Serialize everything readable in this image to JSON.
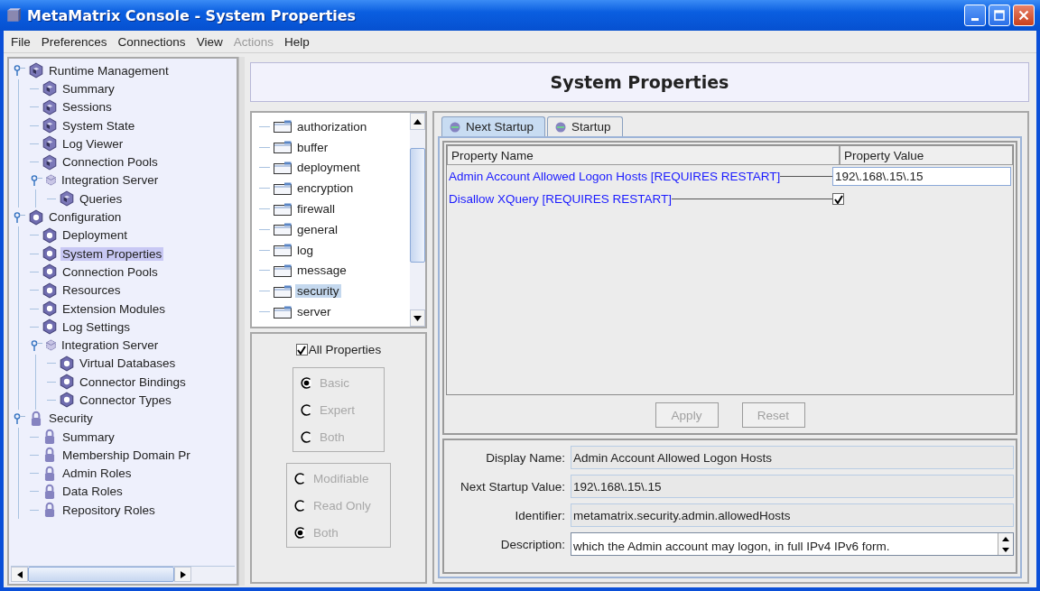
{
  "window": {
    "title": "MetaMatrix Console  - System Properties"
  },
  "menu": [
    {
      "label": "File",
      "disabled": false
    },
    {
      "label": "Preferences",
      "disabled": false
    },
    {
      "label": "Connections",
      "disabled": false
    },
    {
      "label": "View",
      "disabled": false
    },
    {
      "label": "Actions",
      "disabled": true
    },
    {
      "label": "Help",
      "disabled": false
    }
  ],
  "navigation_tree": [
    {
      "label": "Runtime Management",
      "kind": "runtime",
      "selected": false,
      "expanded": true,
      "children": [
        {
          "label": "Summary",
          "kind": "runtime",
          "selected": false
        },
        {
          "label": "Sessions",
          "kind": "runtime",
          "selected": false
        },
        {
          "label": "System State",
          "kind": "runtime",
          "selected": false
        },
        {
          "label": "Log Viewer",
          "kind": "runtime",
          "selected": false
        },
        {
          "label": "Connection Pools",
          "kind": "runtime",
          "selected": false
        },
        {
          "label": "Integration Server",
          "kind": "server",
          "selected": false,
          "expanded": true,
          "children": [
            {
              "label": "Queries",
              "kind": "runtime",
              "selected": false
            }
          ]
        }
      ]
    },
    {
      "label": "Configuration",
      "kind": "config",
      "selected": false,
      "expanded": true,
      "children": [
        {
          "label": "Deployment",
          "kind": "config",
          "selected": false
        },
        {
          "label": "System Properties",
          "kind": "config",
          "selected": true
        },
        {
          "label": "Connection Pools",
          "kind": "config",
          "selected": false
        },
        {
          "label": "Resources",
          "kind": "config",
          "selected": false
        },
        {
          "label": "Extension Modules",
          "kind": "config",
          "selected": false
        },
        {
          "label": "Log Settings",
          "kind": "config",
          "selected": false
        },
        {
          "label": "Integration Server",
          "kind": "server",
          "selected": false,
          "expanded": true,
          "children": [
            {
              "label": "Virtual Databases",
              "kind": "config",
              "selected": false
            },
            {
              "label": "Connector Bindings",
              "kind": "config",
              "selected": false
            },
            {
              "label": "Connector Types",
              "kind": "config",
              "selected": false
            }
          ]
        }
      ]
    },
    {
      "label": "Security",
      "kind": "security",
      "selected": false,
      "expanded": true,
      "children": [
        {
          "label": "Summary",
          "kind": "security",
          "selected": false
        },
        {
          "label": "Membership Domain Pr",
          "kind": "security",
          "selected": false
        },
        {
          "label": "Admin Roles",
          "kind": "security",
          "selected": false
        },
        {
          "label": "Data Roles",
          "kind": "security",
          "selected": false
        },
        {
          "label": "Repository Roles",
          "kind": "security",
          "selected": false
        }
      ]
    }
  ],
  "page_title": "System Properties",
  "categories": [
    {
      "label": "authorization",
      "selected": false
    },
    {
      "label": "buffer",
      "selected": false
    },
    {
      "label": "deployment",
      "selected": false
    },
    {
      "label": "encryption",
      "selected": false
    },
    {
      "label": "firewall",
      "selected": false
    },
    {
      "label": "general",
      "selected": false
    },
    {
      "label": "log",
      "selected": false
    },
    {
      "label": "message",
      "selected": false
    },
    {
      "label": "security",
      "selected": true
    },
    {
      "label": "server",
      "selected": false
    }
  ],
  "filters": {
    "all_properties": {
      "label": "All Properties",
      "checked": true
    },
    "groups": [
      {
        "disabled": true,
        "options": [
          {
            "label": "Basic",
            "selected": true
          },
          {
            "label": "Expert",
            "selected": false
          },
          {
            "label": "Both",
            "selected": false
          }
        ]
      },
      {
        "disabled": true,
        "options": [
          {
            "label": "Modifiable",
            "selected": false
          },
          {
            "label": "Read Only",
            "selected": false
          },
          {
            "label": "Both",
            "selected": true
          }
        ]
      }
    ]
  },
  "tabs": [
    {
      "label": "Next Startup",
      "selected": true
    },
    {
      "label": "Startup",
      "selected": false
    }
  ],
  "table": {
    "columns": [
      "Property Name",
      "Property Value"
    ],
    "rows": [
      {
        "name": "Admin Account Allowed Logon Hosts [REQUIRES RESTART]",
        "kind": "text",
        "value": "192\\.168\\.15\\.15"
      },
      {
        "name": "Disallow XQuery [REQUIRES RESTART]",
        "kind": "checkbox",
        "checked": true
      }
    ]
  },
  "buttons": [
    {
      "label": "Apply",
      "disabled": true
    },
    {
      "label": "Reset",
      "disabled": true
    }
  ],
  "details": [
    {
      "label": "Display Name:",
      "value": "Admin Account Allowed Logon Hosts"
    },
    {
      "label": "Next Startup Value:",
      "value": "192\\.168\\.15\\.15"
    },
    {
      "label": "Identifier:",
      "value": "metamatrix.security.admin.allowedHosts"
    }
  ],
  "description": {
    "label": "Description:",
    "value": "which the Admin account may logon, in full IPv4 IPv6 form."
  }
}
